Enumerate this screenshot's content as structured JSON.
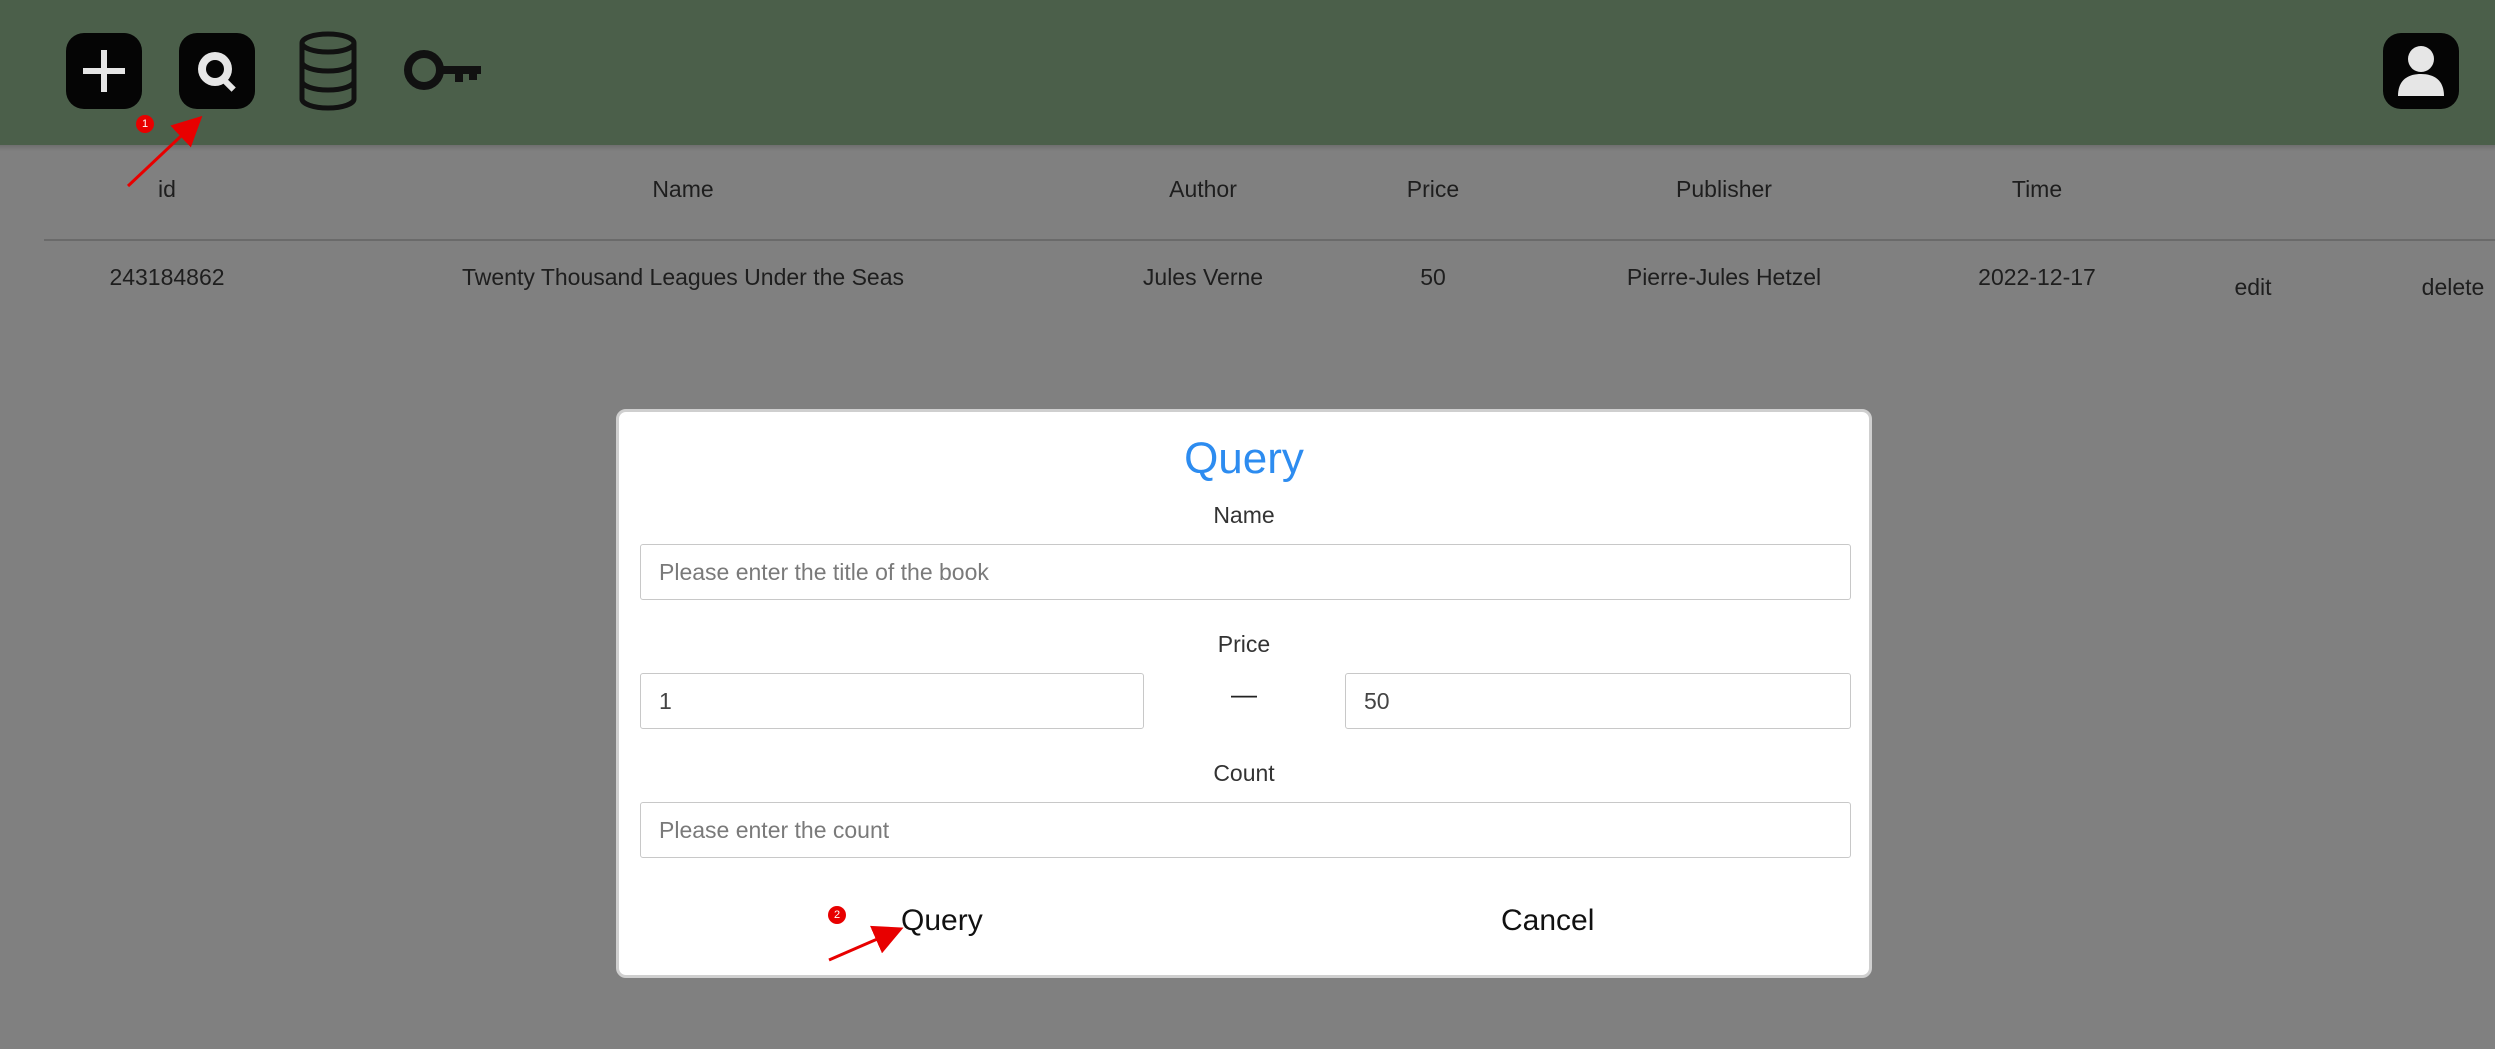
{
  "toolbar": {
    "items": [
      {
        "icon": "plus-icon"
      },
      {
        "icon": "search-icon"
      },
      {
        "icon": "database-icon"
      },
      {
        "icon": "key-icon"
      }
    ],
    "user_icon": "user-icon"
  },
  "table": {
    "headers": [
      "id",
      "Name",
      "Author",
      "Price",
      "Publisher",
      "Time"
    ],
    "rows": [
      {
        "id": "243184862",
        "name": "Twenty Thousand Leagues Under the Seas",
        "author": "Jules Verne",
        "price": "50",
        "publisher": "Pierre-Jules Hetzel",
        "time": "2022-12-17",
        "edit_label": "edit",
        "delete_label": "delete"
      }
    ]
  },
  "modal": {
    "title": "Query",
    "name_label": "Name",
    "name_placeholder": "Please enter the title of the book",
    "name_value": "",
    "price_label": "Price",
    "price_min_value": "1",
    "price_separator": "—",
    "price_max_value": "50",
    "count_label": "Count",
    "count_placeholder": "Please enter the count",
    "count_value": "",
    "query_button": "Query",
    "cancel_button": "Cancel"
  },
  "annotations": {
    "badge_1": "1",
    "badge_2": "2",
    "color": "#e80000"
  },
  "colors": {
    "topbar": "#4b5f4a",
    "overlay": "#808080",
    "title": "#2d8cf0"
  }
}
